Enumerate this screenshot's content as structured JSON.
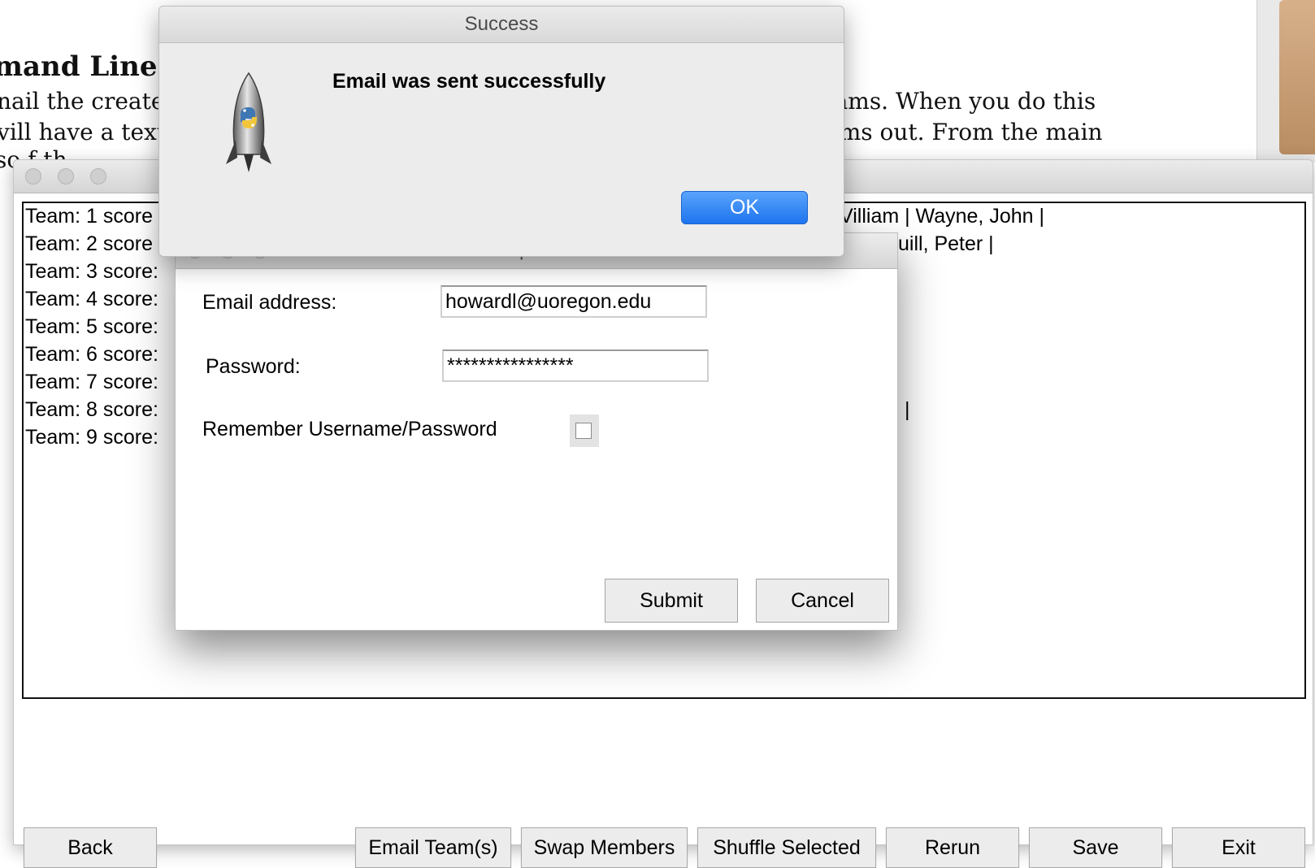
{
  "document": {
    "heading": "mand Line",
    "lines": [
      "nail the created",
      "vill have a text",
      "eams.  When you do this",
      "ams out.  From the main",
      "so   f th"
    ]
  },
  "main_window": {
    "team_rows": [
      "Team: 1 score",
      "Team: 2 score",
      "Team: 3 score:",
      "Team: 4 score:",
      "Team: 5 score:",
      "Team: 6 score:",
      "Team: 7 score:",
      "Team: 8 score:",
      "Team: 9 score:"
    ],
    "row1_right": "Villiam | Wayne, John |",
    "row2_right": "uill, Peter |",
    "row8_right": "|",
    "buttons": {
      "back": "Back",
      "email_teams": "Email Team(s)",
      "swap_members": "Swap Members",
      "shuffle_selected": "Shuffle Selected",
      "rerun": "Rerun",
      "save": "Save",
      "exit": "Exit"
    }
  },
  "options_dialog": {
    "title": "Options",
    "email_label": "Email address:",
    "email_value": "howardl@uoregon.edu",
    "password_label": "Password:",
    "password_value": "****************",
    "remember_label": "Remember Username/Password",
    "remember_checked": false,
    "submit": "Submit",
    "cancel": "Cancel"
  },
  "alert": {
    "title": "Success",
    "message": "Email was sent successfully",
    "ok": "OK",
    "icon": "python-launcher-rocket-icon"
  },
  "colors": {
    "ok_button": "#1d74ef",
    "window_bg": "#ececec"
  }
}
